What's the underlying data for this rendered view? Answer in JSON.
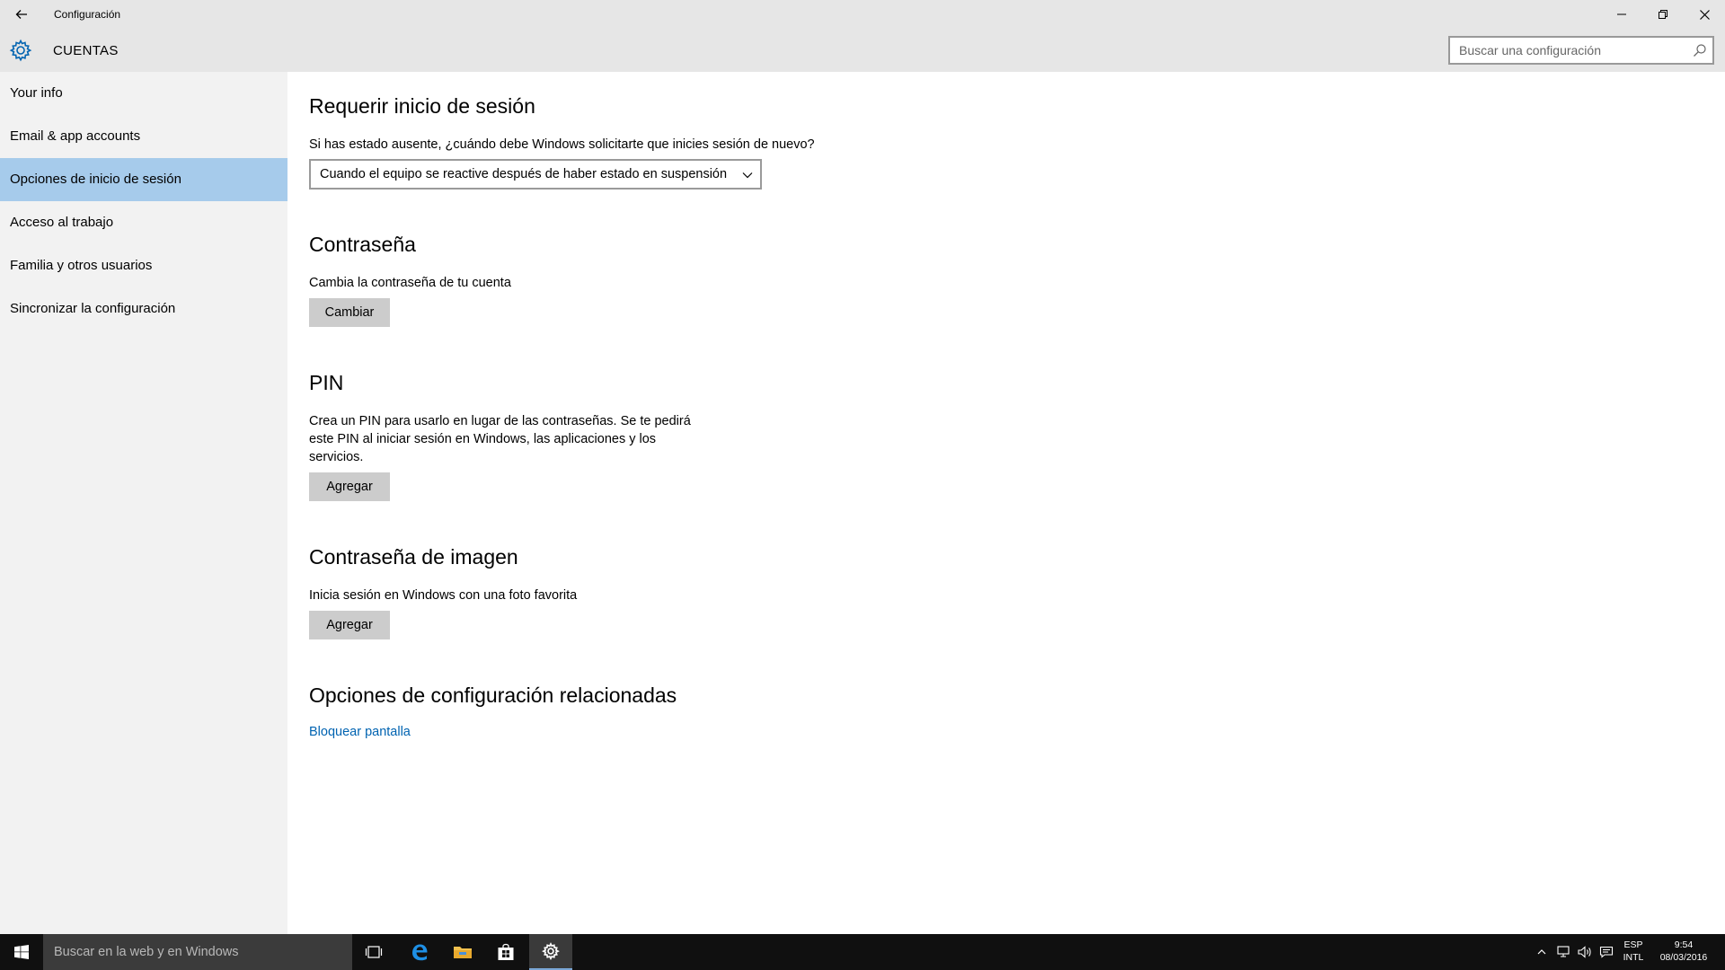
{
  "window": {
    "title": "Configuración"
  },
  "header": {
    "section_title": "CUENTAS",
    "search_placeholder": "Buscar una configuración"
  },
  "sidebar": {
    "items": [
      {
        "label": "Your info",
        "active": false
      },
      {
        "label": "Email & app accounts",
        "active": false
      },
      {
        "label": "Opciones de inicio de sesión",
        "active": true
      },
      {
        "label": "Acceso al trabajo",
        "active": false
      },
      {
        "label": "Familia y otros usuarios",
        "active": false
      },
      {
        "label": "Sincronizar la configuración",
        "active": false
      }
    ]
  },
  "main": {
    "require_signin": {
      "heading": "Requerir inicio de sesión",
      "question": "Si has estado ausente, ¿cuándo debe Windows solicitarte que inicies sesión de nuevo?",
      "selected_option": "Cuando el equipo se reactive después de haber estado en suspensión"
    },
    "password": {
      "heading": "Contraseña",
      "description": "Cambia la contraseña de tu cuenta",
      "button": "Cambiar"
    },
    "pin": {
      "heading": "PIN",
      "description_line1": "Crea un PIN para usarlo en lugar de las contraseñas. Se te pedirá",
      "description_line2": "este PIN al iniciar sesión en Windows, las aplicaciones y los",
      "description_line3": "servicios.",
      "button": "Agregar"
    },
    "picture_password": {
      "heading": "Contraseña de imagen",
      "description": "Inicia sesión en Windows con una foto favorita",
      "button": "Agregar"
    },
    "related": {
      "heading": "Opciones de configuración relacionadas",
      "link": "Bloquear pantalla"
    }
  },
  "taskbar": {
    "search_placeholder": "Buscar en la web y en Windows",
    "language": "ESP",
    "layout": "INTL",
    "time": "9:54",
    "date": "08/03/2016"
  },
  "colors": {
    "accent": "#0063b1",
    "active_nav": "#a6cbeb",
    "chrome": "#e6e6e6",
    "sidebar": "#f2f2f2",
    "taskbar": "#101010"
  }
}
